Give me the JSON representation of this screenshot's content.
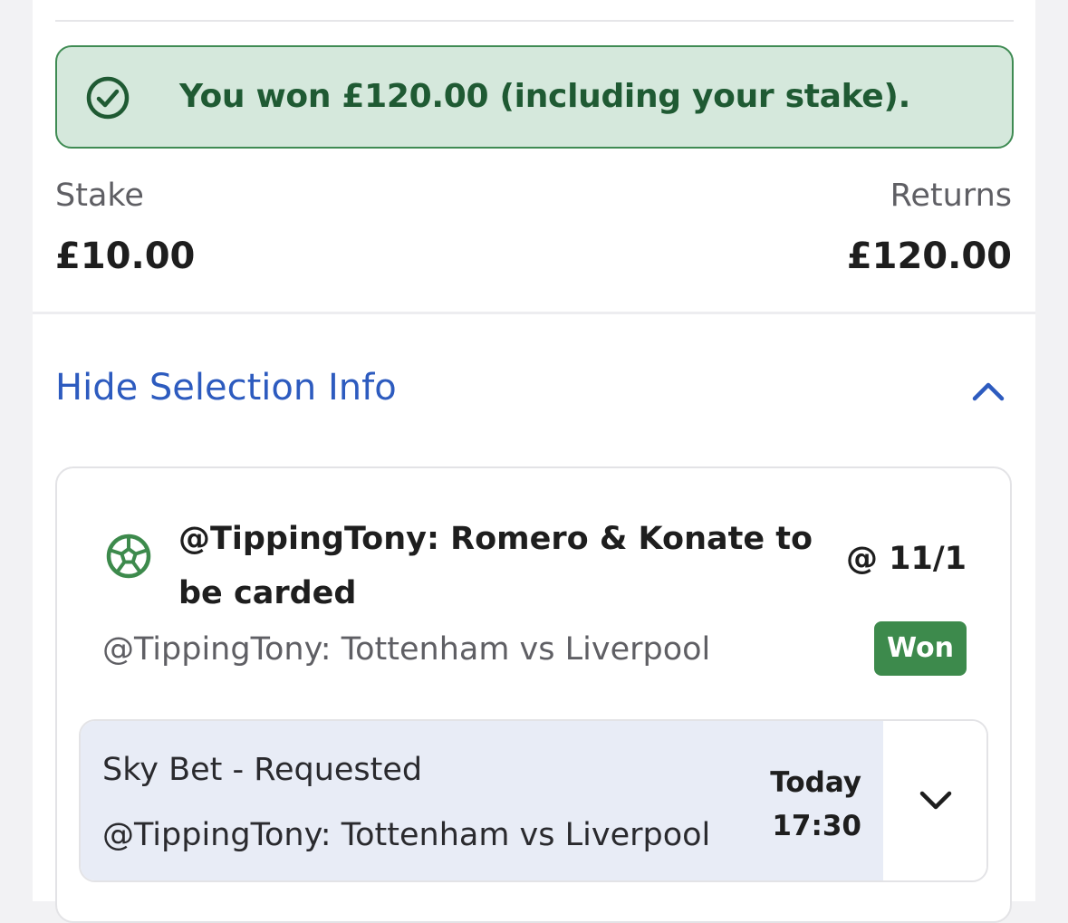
{
  "banner": {
    "message": "You won £120.00 (including your stake).",
    "icon": "check-circle-icon",
    "color": "#1f5a33",
    "background": "#d5e8dc"
  },
  "summary": {
    "stake_label": "Stake",
    "stake_value": "£10.00",
    "returns_label": "Returns",
    "returns_value": "£120.00"
  },
  "selection_toggle": {
    "label": "Hide Selection Info",
    "icon": "chevron-up-icon",
    "color": "#2d5bbf"
  },
  "selection": {
    "sport_icon": "football-icon",
    "title": "@TippingTony: Romero & Konate to be carded",
    "odds": "@ 11/1",
    "event": "@TippingTony: Tottenham vs Liverpool",
    "status": "Won",
    "status_color": "#3d8a4c"
  },
  "market": {
    "name": "Sky Bet - Requested",
    "event": "@TippingTony: Tottenham vs Liverpool",
    "day": "Today",
    "time": "17:30",
    "expand_icon": "chevron-down-icon"
  }
}
